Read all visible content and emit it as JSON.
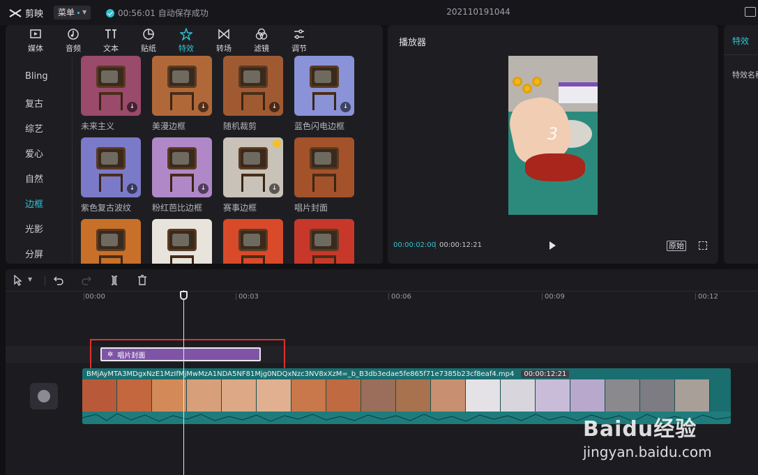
{
  "app": {
    "name": "剪映",
    "menu_label": "菜单",
    "save_status": "00:56:01 自动保存成功",
    "project_name": "202110191044"
  },
  "tabs": [
    {
      "label": "媒体",
      "icon": "media-icon"
    },
    {
      "label": "音频",
      "icon": "audio-icon"
    },
    {
      "label": "文本",
      "icon": "text-icon"
    },
    {
      "label": "贴纸",
      "icon": "sticker-icon"
    },
    {
      "label": "特效",
      "icon": "effects-icon",
      "active": true
    },
    {
      "label": "转场",
      "icon": "transition-icon"
    },
    {
      "label": "滤镜",
      "icon": "filter-icon"
    },
    {
      "label": "调节",
      "icon": "adjust-icon"
    }
  ],
  "categories": [
    {
      "label": "Bling"
    },
    {
      "label": "复古"
    },
    {
      "label": "综艺"
    },
    {
      "label": "爱心"
    },
    {
      "label": "自然"
    },
    {
      "label": "边框",
      "active": true
    },
    {
      "label": "光影"
    },
    {
      "label": "分屏"
    }
  ],
  "effects": [
    {
      "label": "未来主义",
      "color": "#9a4a6a"
    },
    {
      "label": "美漫边框",
      "color": "#b06838"
    },
    {
      "label": "随机裁剪",
      "color": "#a05a32"
    },
    {
      "label": "蓝色闪电边框",
      "color": "#8a92d8"
    },
    {
      "label": "紫色复古波纹",
      "color": "#7a7ac8"
    },
    {
      "label": "粉红芭比边框",
      "color": "#b088c8"
    },
    {
      "label": "赛事边框",
      "color": "#c8c2b8"
    },
    {
      "label": "唱片封面",
      "color": "#a4522a"
    },
    {
      "label": "",
      "color": "#c8702a"
    },
    {
      "label": "",
      "color": "#e8e4dc"
    },
    {
      "label": "",
      "color": "#d84a2a"
    },
    {
      "label": "",
      "color": "#c8382a"
    }
  ],
  "player": {
    "title": "播放器",
    "current_time": "00:00:02:00",
    "total_time": "00:00:12:21",
    "ratio_label": "原始",
    "overlay_number": "3"
  },
  "props": {
    "tab": "特效",
    "label": "特效名称"
  },
  "timeline": {
    "ruler": [
      "00:00",
      "00:03",
      "00:06",
      "00:09",
      "00:12"
    ],
    "effect_clip": "唱片封面",
    "video_file": "BMjAyMTA3MDgxNzE1MzIfMjMwMzA1NDA5NF81Mjg0NDQxNzc3NV8xXzM=_b_B3db3edae5fe865f71e7385b23cf8eaf4.mp4",
    "video_duration": "00:00:12:21"
  },
  "watermark": {
    "brand": "Baidu经验",
    "url": "jingyan.baidu.com"
  },
  "colors": {
    "accent": "#2fc4d4",
    "effect_clip": "#7f54a6",
    "highlight": "#e03131"
  }
}
